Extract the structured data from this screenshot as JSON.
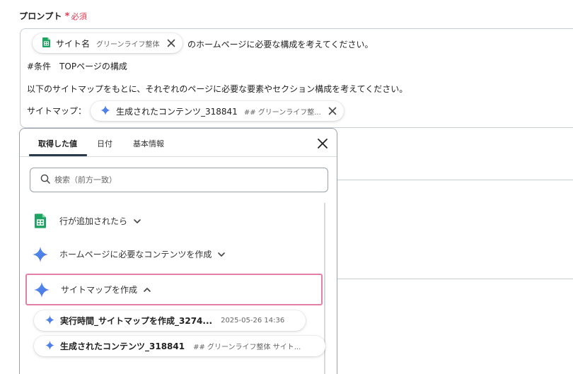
{
  "field": {
    "label": "プロンプト",
    "required_mark": "*",
    "required_text": "必須"
  },
  "prompt": {
    "chip1": {
      "icon": "google-sheets-icon",
      "name": "サイト名",
      "value": "グリーンライフ整体"
    },
    "line1_suffix": "のホームページに必要な構成を考えてください。",
    "line2": "#条件　TOPページの構成",
    "line3": "以下のサイトマップをもとに、それぞれのページに必要な要素やセクション構成を考えてください。",
    "line4_prefix": "サイトマップ：",
    "chip2": {
      "icon": "gemini-sparkle-icon",
      "name": "生成されたコンテンツ_318841",
      "value": "## グリーンライフ整..."
    }
  },
  "picker": {
    "tabs": [
      {
        "label": "取得した値",
        "active": true
      },
      {
        "label": "日付",
        "active": false
      },
      {
        "label": "基本情報",
        "active": false
      }
    ],
    "search_placeholder": "検索（前方一致）",
    "groups": [
      {
        "icon": "google-sheets-icon",
        "label": "行が追加されたら",
        "expanded": false
      },
      {
        "icon": "gemini-sparkle-icon",
        "label": "ホームページに必要なコンテンツを作成",
        "expanded": false
      },
      {
        "icon": "gemini-sparkle-icon",
        "label": "サイトマップを作成",
        "expanded": true,
        "selected": true
      }
    ],
    "items": [
      {
        "icon": "gemini-sparkle-icon",
        "name": "実行時間_サイトマップを作成_3274...",
        "meta": "2025-05-26 14:36"
      },
      {
        "icon": "gemini-sparkle-icon",
        "name": "生成されたコンテンツ_318841",
        "meta": "## グリーンライフ整体 サイト..."
      }
    ]
  },
  "colors": {
    "required": "#e53950",
    "selected_border": "#e37fa6",
    "sheets_green": "#1ea362",
    "gemini_blue": "#4a7fe8",
    "tab_underline": "#2b3a4a"
  }
}
